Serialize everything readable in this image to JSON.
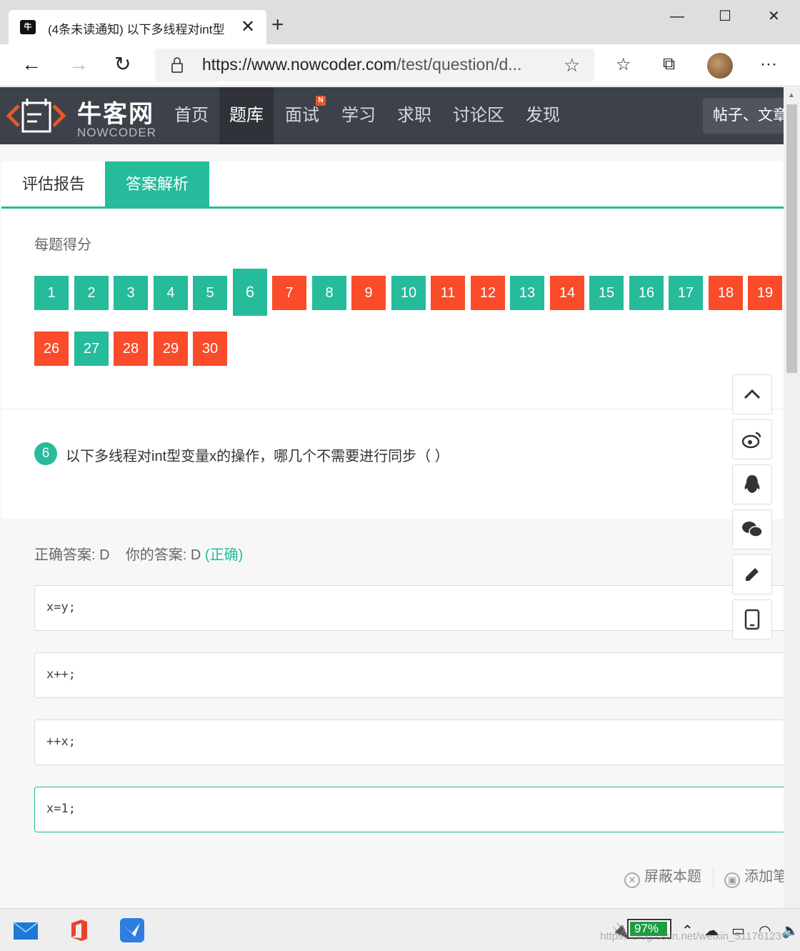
{
  "browser": {
    "tab_title": "(4条未读通知) 以下多线程对int型",
    "tab_favicon": "牛",
    "new_tab": "+",
    "minimize": "—",
    "maximize": "☐",
    "close": "✕",
    "url_host": "https://www.nowcoder.com",
    "url_path": "/test/question/d...",
    "more": "···"
  },
  "site": {
    "logo_cn": "牛客网",
    "logo_en": "NOWCODER",
    "nav": [
      "首页",
      "题库",
      "面试",
      "学习",
      "求职",
      "讨论区",
      "发现"
    ],
    "nav_active": "题库",
    "nav_badge": "N",
    "search_placeholder": "帖子、文章"
  },
  "tabs": {
    "report": "评估报告",
    "analysis": "答案解析"
  },
  "score_label": "每题得分",
  "questions": [
    {
      "n": "1",
      "ok": true
    },
    {
      "n": "2",
      "ok": true
    },
    {
      "n": "3",
      "ok": true
    },
    {
      "n": "4",
      "ok": true
    },
    {
      "n": "5",
      "ok": true
    },
    {
      "n": "6",
      "ok": true,
      "current": true
    },
    {
      "n": "7",
      "ok": false
    },
    {
      "n": "8",
      "ok": true
    },
    {
      "n": "9",
      "ok": false
    },
    {
      "n": "10",
      "ok": true
    },
    {
      "n": "11",
      "ok": false
    },
    {
      "n": "12",
      "ok": false
    },
    {
      "n": "13",
      "ok": true
    },
    {
      "n": "14",
      "ok": false
    },
    {
      "n": "15",
      "ok": true
    },
    {
      "n": "16",
      "ok": true
    },
    {
      "n": "17",
      "ok": true
    },
    {
      "n": "18",
      "ok": false
    },
    {
      "n": "19",
      "ok": false
    },
    {
      "n": "26",
      "ok": false
    },
    {
      "n": "27",
      "ok": true
    },
    {
      "n": "28",
      "ok": false
    },
    {
      "n": "29",
      "ok": false
    },
    {
      "n": "30",
      "ok": false
    }
  ],
  "question": {
    "number": "6",
    "text": "以下多线程对int型变量x的操作，哪几个不需要进行同步（    ）"
  },
  "answer": {
    "correct_label": "正确答案: D",
    "yours_label": "你的答案: D",
    "status": "(正确)"
  },
  "options": [
    {
      "code": "x=y;",
      "correct": false
    },
    {
      "code": "x++;",
      "correct": false
    },
    {
      "code": "++x;",
      "correct": false
    },
    {
      "code": "x=1;",
      "correct": true
    }
  ],
  "actions": {
    "hide": "屏蔽本题",
    "note": "添加笔"
  },
  "taskbar": {
    "battery": "97%",
    "watermark": "https://blog.csdn.net/weixin_51176123"
  },
  "colors": {
    "accent": "#25bb9b",
    "wrong": "#fa4b2a",
    "nav_bg": "#3d4149"
  }
}
